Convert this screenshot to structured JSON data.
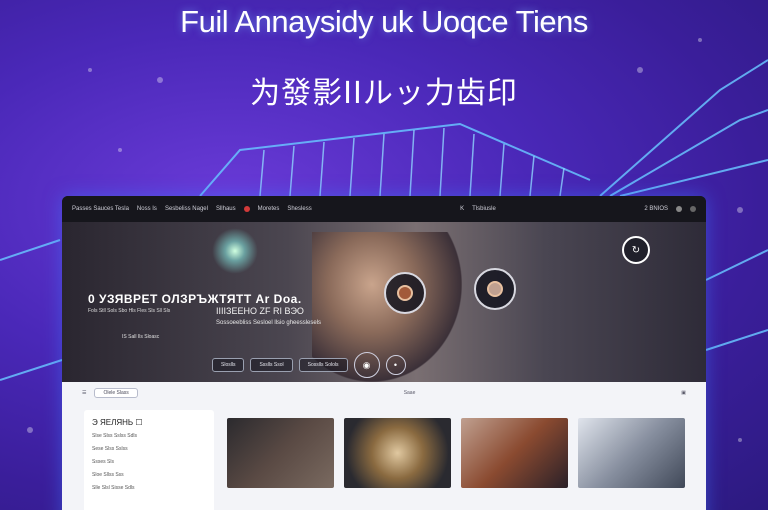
{
  "headline": "Fuil Annaysidy  uk Uoqce Tiens",
  "subline": "为發影IIルッ力齿印",
  "topbar": {
    "brand": "Passes Sauces Tesla",
    "item1": "Noss Is",
    "item2": "Sesbeliss Nagel",
    "item3": "Sllhaus",
    "item4": "Moretes",
    "item5": "Shesless",
    "nav1": "K",
    "nav2": "Tlsbiusle",
    "account": "2 BNIOS"
  },
  "hero": {
    "title": "0 УЗЯВРЕТ ОЛЗРЪЖТЯТТ Ar Doa.",
    "subtitle": "Fols Stll Sols Sbo Hls Fles Sls Sll Sls",
    "caption": "IIIIЗЕЕНО ZF RI ВЭО",
    "caption2": "Sossoeebliss Sesloel llsio gheesslesels",
    "meta": "IS  Sall Ils Sloasc",
    "btn1": "Sloslls",
    "btn2": "Ssslls Ssol",
    "btn3": "Sosslls Solols"
  },
  "content": {
    "search": "Olele Slass",
    "filter": "Saae",
    "side_title": "Э  ЯЕЛЯНЬ  ☐",
    "side_rows": [
      "Slse Slss Sslss Sdls",
      "Sese Slss Sslss",
      "Ssses Sls",
      "Sloe Sllss Sss",
      "Slle Slsl Sisse Sdls"
    ]
  },
  "colors": {
    "accent": "#6a3bd8",
    "glow": "#4fa8ff",
    "window": "#1a1a22"
  }
}
